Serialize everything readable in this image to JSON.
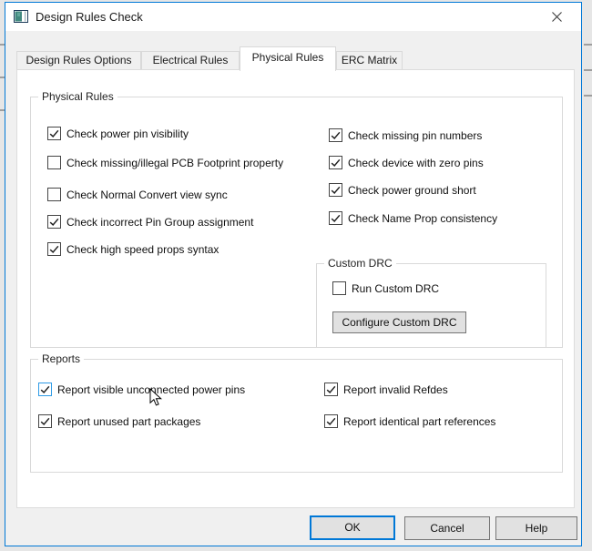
{
  "window": {
    "title": "Design Rules Check"
  },
  "tabs": [
    {
      "label": "Design Rules Options",
      "active": false
    },
    {
      "label": "Electrical Rules",
      "active": false
    },
    {
      "label": "Physical Rules",
      "active": true
    },
    {
      "label": "ERC Matrix",
      "active": false
    }
  ],
  "physical_rules": {
    "label": "Physical Rules",
    "left": [
      {
        "label": "Check power pin visibility",
        "checked": true
      },
      {
        "label": "Check missing/illegal PCB Footprint property",
        "checked": false
      },
      {
        "label": "Check Normal Convert view sync",
        "checked": false
      },
      {
        "label": "Check incorrect Pin Group assignment",
        "checked": true
      },
      {
        "label": "Check high speed props syntax",
        "checked": true
      }
    ],
    "right": [
      {
        "label": "Check missing pin numbers",
        "checked": true
      },
      {
        "label": "Check device with zero pins",
        "checked": true
      },
      {
        "label": "Check power ground short",
        "checked": true
      },
      {
        "label": "Check Name Prop consistency",
        "checked": true
      }
    ]
  },
  "custom_drc": {
    "label": "Custom DRC",
    "checkbox": {
      "label": "Run Custom DRC",
      "checked": false
    },
    "configure_button": "Configure Custom DRC"
  },
  "reports": {
    "label": "Reports",
    "left": [
      {
        "label": "Report visible unconnected power pins",
        "checked": true,
        "hovered": true
      },
      {
        "label": "Report unused part packages",
        "checked": true
      }
    ],
    "right": [
      {
        "label": "Report invalid Refdes",
        "checked": true
      },
      {
        "label": "Report identical part references",
        "checked": true
      }
    ]
  },
  "footer": {
    "ok": "OK",
    "cancel": "Cancel",
    "help": "Help"
  },
  "colors": {
    "accent": "#0078d7",
    "hover_checkbox_border": "#2e9be6",
    "dialog_bg": "#f0f0f0",
    "titlebar_bg": "#ffffff"
  }
}
